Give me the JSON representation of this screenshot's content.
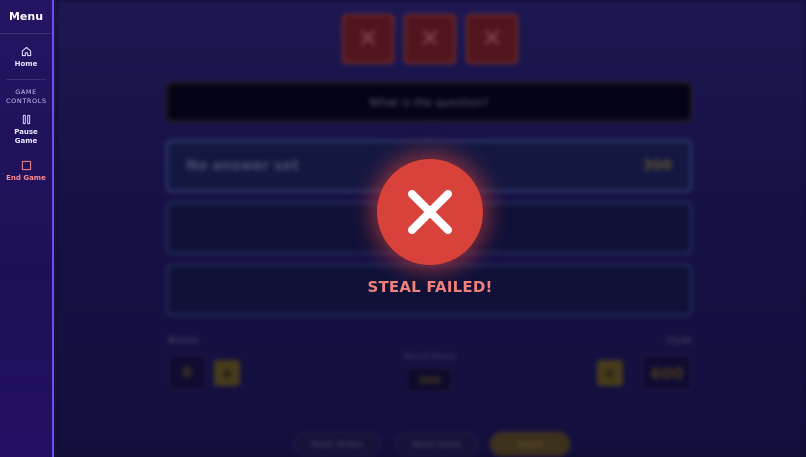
{
  "sidebar": {
    "title": "Menu",
    "home_label": "Home",
    "section_label": "GAME CONTROLS",
    "pause_label": "Pause Game",
    "end_label": "End Game"
  },
  "strikes": [
    "✕",
    "✕",
    "✕"
  ],
  "question": "What is the question?",
  "answers": [
    {
      "text": "No answer set",
      "points": "300"
    },
    {
      "text": "",
      "points": ""
    },
    {
      "text": "",
      "points": ""
    }
  ],
  "teams": {
    "left": {
      "name": "Bosnia",
      "score": "0"
    },
    "right": {
      "name": "Clyde",
      "score": "600"
    }
  },
  "round": {
    "label": "Round Points",
    "value": "300"
  },
  "bottom_buttons": {
    "reset_strikes": "Reset Strikes",
    "reset_game": "Reset Game",
    "award": "Award"
  },
  "overlay": {
    "message": "STEAL FAILED!"
  },
  "colors": {
    "sidebar_border": "#6f4df0",
    "fail_red": "#d8423a",
    "fail_text": "#f0807a"
  }
}
